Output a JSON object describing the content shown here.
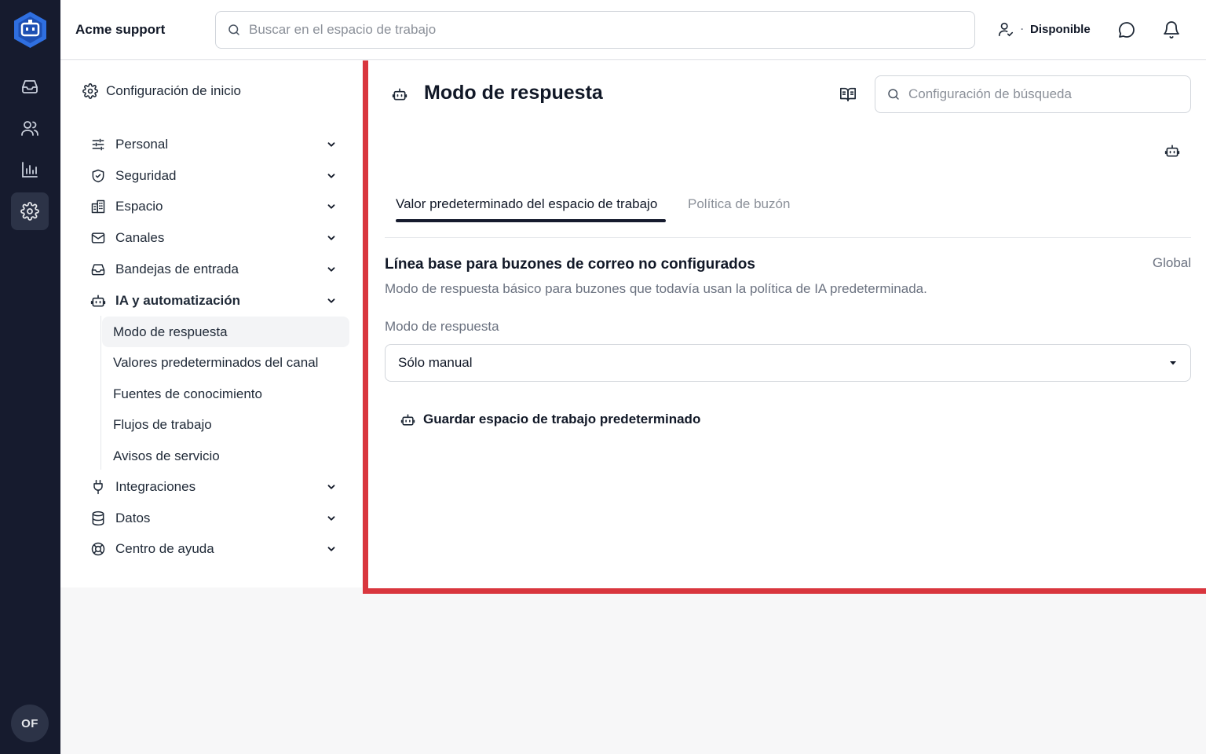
{
  "app": {
    "title": "Acme support"
  },
  "topbar": {
    "search_placeholder": "Buscar en el espacio de trabajo",
    "status_label": "Disponible",
    "status_separator": "·"
  },
  "rail": {
    "items": [
      {
        "icon": "inbox-icon"
      },
      {
        "icon": "users-icon"
      },
      {
        "icon": "chart-icon"
      },
      {
        "icon": "gear-icon",
        "active": true
      }
    ],
    "avatar_initials": "OF"
  },
  "settings_nav": {
    "home_label": "Configuración de inicio",
    "items": [
      {
        "label": "Personal",
        "icon": "sliders-icon"
      },
      {
        "label": "Seguridad",
        "icon": "shield-icon"
      },
      {
        "label": "Espacio",
        "icon": "building-icon"
      },
      {
        "label": "Canales",
        "icon": "mail-icon"
      },
      {
        "label": "Bandejas de entrada",
        "icon": "inbox-icon"
      },
      {
        "label": "IA y automatización",
        "icon": "bot-icon",
        "expanded": true
      },
      {
        "label": "Integraciones",
        "icon": "plug-icon"
      },
      {
        "label": "Datos",
        "icon": "database-icon"
      },
      {
        "label": "Centro de ayuda",
        "icon": "lifebuoy-icon"
      }
    ],
    "sub_items": [
      {
        "label": "Modo de respuesta",
        "active": true
      },
      {
        "label": "Valores predeterminados del canal"
      },
      {
        "label": "Fuentes de conocimiento"
      },
      {
        "label": "Flujos de trabajo"
      },
      {
        "label": "Avisos de servicio"
      }
    ]
  },
  "main": {
    "title": "Modo de respuesta",
    "search_placeholder": "Configuración de búsqueda",
    "tabs": [
      {
        "label": "Valor predeterminado del espacio de trabajo",
        "active": true
      },
      {
        "label": "Política de buzón"
      }
    ],
    "section": {
      "title": "Línea base para buzones de correo no configurados",
      "scope": "Global",
      "description": "Modo de respuesta básico para buzones que todavía usan la política de IA predeterminada.",
      "field_label": "Modo de respuesta",
      "select_value": "Sólo manual",
      "save_label": "Guardar espacio de trabajo predeterminado"
    }
  },
  "colors": {
    "rail_bg": "#161b2e",
    "accent_blue": "#2f6fe0",
    "highlight_border": "#d9363e"
  }
}
